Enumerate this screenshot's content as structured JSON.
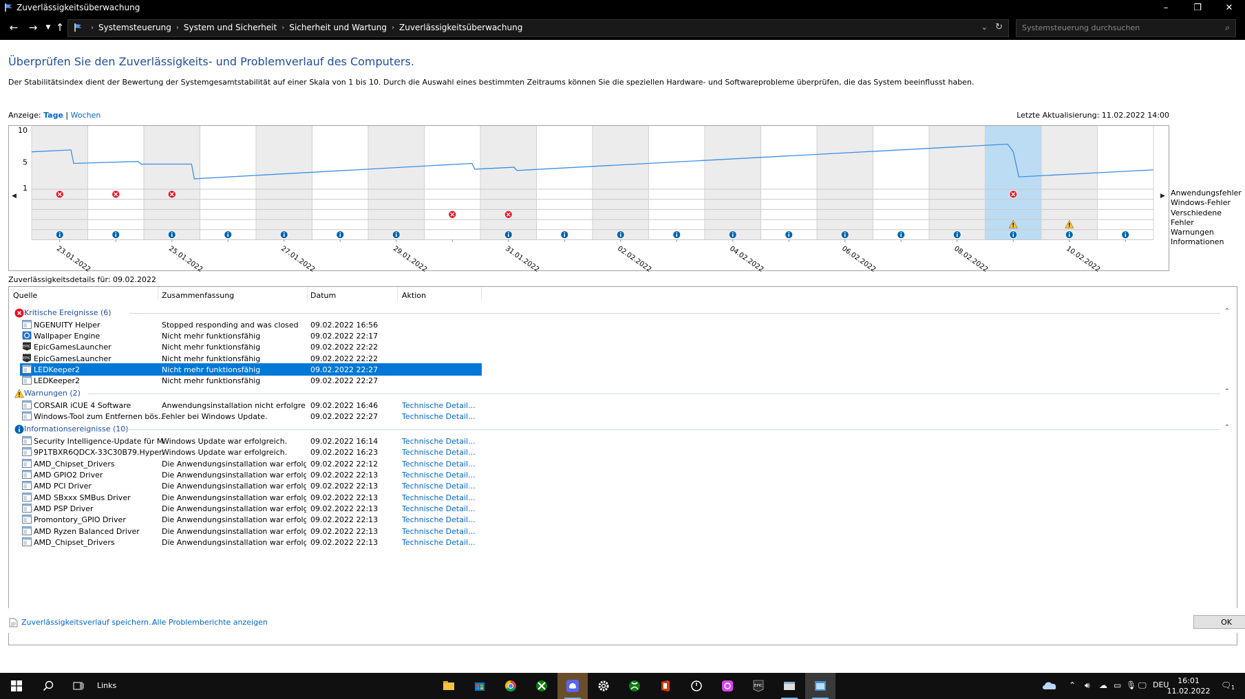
{
  "window": {
    "title": "Zuverlässigkeitsüberwachung",
    "minimize": "–",
    "maximize": "❐",
    "close": "✕"
  },
  "address": {
    "breadcrumbs": [
      "Systemsteuerung",
      "System und Sicherheit",
      "Sicherheit und Wartung",
      "Zuverlässigkeitsüberwachung"
    ],
    "search_placeholder": "Systemsteuerung durchsuchen"
  },
  "page": {
    "heading": "Überprüfen Sie den Zuverlässigkeits- und Problemverlauf des Computers.",
    "description": "Der Stabilitätsindex dient der Bewertung der Systemgesamtstabilität auf einer Skala von 1 bis 10. Durch die Auswahl eines bestimmten Zeitraums können Sie die speziellen Hardware- und Softwareprobleme überprüfen, die das System beeinflusst haben.",
    "view_label": "Anzeige:",
    "view_days": "Tage",
    "view_sep": "|",
    "view_weeks": "Wochen",
    "last_update": "Letzte Aktualisierung: 11.02.2022 14:00",
    "details_for": "Zuverlässigkeitsdetails für: 09.02.2022"
  },
  "chart_data": {
    "type": "line",
    "y_ticks": [
      "10",
      "5",
      "1"
    ],
    "ylim": [
      1,
      10
    ],
    "x_labels": [
      "23.01.2022",
      "25.01.2022",
      "27.01.2022",
      "29.01.2022",
      "31.01.2022",
      "02.02.2022",
      "04.02.2022",
      "06.02.2022",
      "08.02.2022",
      "10.02.2022"
    ],
    "days": 20,
    "selected_day_index": 17,
    "stability_index": [
      [
        0,
        6.6
      ],
      [
        0.7,
        6.9
      ],
      [
        0.75,
        4.8
      ],
      [
        1.9,
        5.1
      ],
      [
        1.95,
        4.7
      ],
      [
        2.85,
        4.7
      ],
      [
        2.9,
        2.4
      ],
      [
        7.85,
        4.8
      ],
      [
        7.9,
        3.9
      ],
      [
        8.6,
        4.2
      ],
      [
        8.65,
        3.7
      ],
      [
        17.4,
        7.8
      ],
      [
        17.5,
        6.6
      ],
      [
        17.6,
        2.7
      ],
      [
        20,
        3.8
      ]
    ],
    "legend": [
      "Anwendungsfehler",
      "Windows-Fehler",
      "Verschiedene Fehler",
      "Warnungen",
      "Informationen"
    ],
    "events": {
      "app_errors": [
        0,
        1,
        2,
        17
      ],
      "windows_errors": [],
      "misc_errors": [
        7,
        8
      ],
      "warnings": [
        17,
        18
      ],
      "information": [
        0,
        1,
        2,
        3,
        4,
        5,
        6,
        8,
        9,
        10,
        11,
        12,
        13,
        14,
        15,
        16,
        17,
        18,
        19
      ]
    }
  },
  "table": {
    "headers": [
      "Quelle",
      "Zusammenfassung",
      "Datum",
      "Aktion"
    ],
    "groups": [
      {
        "label": "Kritische Ereignisse (6)",
        "type": "error",
        "rows": [
          {
            "source": "NGENUITY Helper",
            "summary": "Stopped responding and was closed",
            "date": "09.02.2022 16:56",
            "action": "",
            "icon": "window-icon"
          },
          {
            "source": "Wallpaper Engine",
            "summary": "Nicht mehr funktionsfähig",
            "date": "09.02.2022 22:17",
            "action": "",
            "icon": "wallpaper-engine-icon"
          },
          {
            "source": "EpicGamesLauncher",
            "summary": "Nicht mehr funktionsfähig",
            "date": "09.02.2022 22:22",
            "action": "",
            "icon": "epic-games-icon"
          },
          {
            "source": "EpicGamesLauncher",
            "summary": "Nicht mehr funktionsfähig",
            "date": "09.02.2022 22:22",
            "action": "",
            "icon": "epic-games-icon"
          },
          {
            "source": "LEDKeeper2",
            "summary": "Nicht mehr funktionsfähig",
            "date": "09.02.2022 22:27",
            "action": "",
            "icon": "window-icon",
            "selected": true
          },
          {
            "source": "LEDKeeper2",
            "summary": "Nicht mehr funktionsfähig",
            "date": "09.02.2022 22:27",
            "action": "",
            "icon": "window-icon"
          }
        ]
      },
      {
        "label": "Warnungen (2)",
        "type": "warning",
        "rows": [
          {
            "source": "CORSAIR iCUE 4 Software",
            "summary": "Anwendungsinstallation nicht erfolgreich",
            "date": "09.02.2022 16:46",
            "action": "Technische Detail...",
            "icon": "window-icon"
          },
          {
            "source": "Windows-Tool zum Entfernen bös...",
            "summary": "Fehler bei Windows Update.",
            "date": "09.02.2022 22:27",
            "action": "Technische Detail...",
            "icon": "window-icon"
          }
        ]
      },
      {
        "label": "Informationsereignisse (10)",
        "type": "info",
        "rows": [
          {
            "source": "Security Intelligence-Update für M...",
            "summary": "Windows Update war erfolgreich.",
            "date": "09.02.2022 16:14",
            "action": "Technische Detail...",
            "icon": "window-icon"
          },
          {
            "source": "9P1TBXR6QDCX-33C30B79.Hyper...",
            "summary": "Windows Update war erfolgreich.",
            "date": "09.02.2022 16:23",
            "action": "Technische Detail...",
            "icon": "window-icon"
          },
          {
            "source": "AMD_Chipset_Drivers",
            "summary": "Die Anwendungsinstallation war erfolgr...",
            "date": "09.02.2022 22:12",
            "action": "Technische Detail...",
            "icon": "window-icon"
          },
          {
            "source": "AMD GPIO2 Driver",
            "summary": "Die Anwendungsinstallation war erfolgr...",
            "date": "09.02.2022 22:13",
            "action": "Technische Detail...",
            "icon": "window-icon"
          },
          {
            "source": "AMD PCI Driver",
            "summary": "Die Anwendungsinstallation war erfolgr...",
            "date": "09.02.2022 22:13",
            "action": "Technische Detail...",
            "icon": "window-icon"
          },
          {
            "source": "AMD SBxxx SMBus Driver",
            "summary": "Die Anwendungsinstallation war erfolgr...",
            "date": "09.02.2022 22:13",
            "action": "Technische Detail...",
            "icon": "window-icon"
          },
          {
            "source": "AMD PSP Driver",
            "summary": "Die Anwendungsinstallation war erfolgr...",
            "date": "09.02.2022 22:13",
            "action": "Technische Detail...",
            "icon": "window-icon"
          },
          {
            "source": "Promontory_GPIO Driver",
            "summary": "Die Anwendungsinstallation war erfolgr...",
            "date": "09.02.2022 22:13",
            "action": "Technische Detail...",
            "icon": "window-icon"
          },
          {
            "source": "AMD Ryzen Balanced Driver",
            "summary": "Die Anwendungsinstallation war erfolgr...",
            "date": "09.02.2022 22:13",
            "action": "Technische Detail...",
            "icon": "window-icon"
          },
          {
            "source": "AMD_Chipset_Drivers",
            "summary": "Die Anwendungsinstallation war erfolgr...",
            "date": "09.02.2022 22:13",
            "action": "Technische Detail...",
            "icon": "window-icon"
          }
        ]
      }
    ]
  },
  "footer": {
    "save_link": "Zuverlässigkeitsverlauf speichern...",
    "all_reports_link": "Alle Problemberichte anzeigen",
    "ok_label": "OK"
  },
  "taskbar": {
    "links_label": "Links",
    "language": "DEU",
    "time": "16:01",
    "date": "11.02.2022",
    "notification_count": "1",
    "apps": [
      "file-explorer-icon",
      "store-icon",
      "chrome-icon",
      "xbox-app-icon",
      "discord-icon",
      "settings-icon",
      "xbox-icon",
      "office-icon",
      "ngenuity-icon",
      "brave-icon",
      "epic-games-icon",
      "explorer-window-icon",
      "reliability-monitor-icon"
    ]
  },
  "colors": {
    "accent": "#0078d7",
    "link": "#0066cc",
    "heading": "#1e4e9e",
    "error": "#e81123",
    "warning": "#ffc83d",
    "info": "#0063b1",
    "selected_column": "#bcdcf4"
  }
}
